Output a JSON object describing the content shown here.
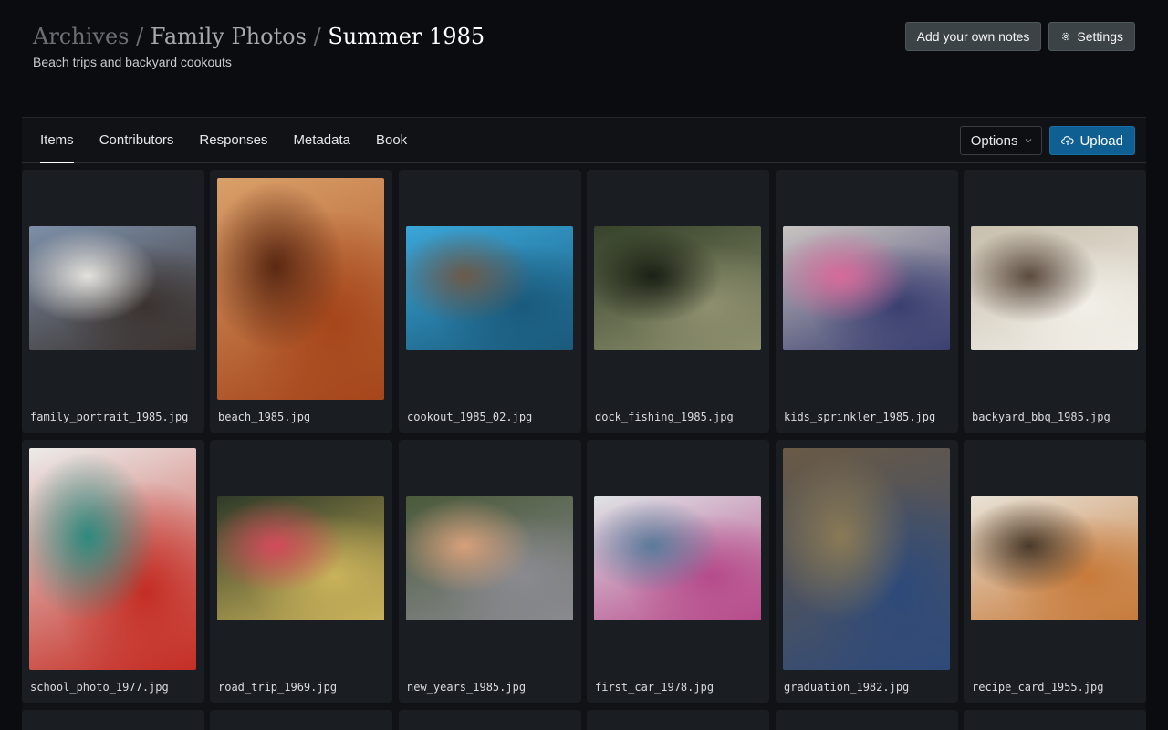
{
  "breadcrumb": {
    "items": [
      "Archives",
      "Family Photos",
      "Summer 1985"
    ],
    "separator": "/"
  },
  "subtitle": "Beach trips and backyard cookouts",
  "header_actions": {
    "notes_label": "Add your own notes",
    "settings_label": "Settings"
  },
  "tabs": [
    {
      "label": "Items",
      "active": true
    },
    {
      "label": "Contributors",
      "active": false
    },
    {
      "label": "Responses",
      "active": false
    },
    {
      "label": "Metadata",
      "active": false
    },
    {
      "label": "Book",
      "active": false
    }
  ],
  "toolbar": {
    "options_label": "Options",
    "upload_label": "Upload"
  },
  "items": [
    {
      "filename": "family_portrait_1985.jpg",
      "orientation": "landscape",
      "colors": [
        "#7d8fa8",
        "#3b3330",
        "#e4e2dd"
      ]
    },
    {
      "filename": "beach_1985.jpg",
      "orientation": "portrait",
      "colors": [
        "#d9a06a",
        "#a5451a",
        "#5a2812"
      ]
    },
    {
      "filename": "cookout_1985_02.jpg",
      "orientation": "landscape",
      "colors": [
        "#3aa6d8",
        "#1a5a7c",
        "#6c5a4a"
      ]
    },
    {
      "filename": "dock_fishing_1985.jpg",
      "orientation": "landscape",
      "colors": [
        "#36432a",
        "#8d8f6e",
        "#1a2014"
      ]
    },
    {
      "filename": "kids_sprinkler_1985.jpg",
      "orientation": "landscape",
      "colors": [
        "#c9c3c1",
        "#3a3f70",
        "#d86a9a"
      ]
    },
    {
      "filename": "backyard_bbq_1985.jpg",
      "orientation": "landscape",
      "colors": [
        "#c8bfad",
        "#f2efe8",
        "#5a4a3d"
      ]
    },
    {
      "filename": "school_photo_1977.jpg",
      "orientation": "portrait",
      "colors": [
        "#ececea",
        "#c42d24",
        "#2d8a7e"
      ]
    },
    {
      "filename": "road_trip_1969.jpg",
      "orientation": "landscape",
      "colors": [
        "#2f3a28",
        "#c9b25a",
        "#d34a5a"
      ]
    },
    {
      "filename": "new_years_1985.jpg",
      "orientation": "landscape",
      "colors": [
        "#4a5a3a",
        "#8a8a90",
        "#d7a07a"
      ]
    },
    {
      "filename": "first_car_1978.jpg",
      "orientation": "landscape",
      "colors": [
        "#dfe3e6",
        "#b64a8a",
        "#5a7a9a"
      ]
    },
    {
      "filename": "graduation_1982.jpg",
      "orientation": "portrait",
      "colors": [
        "#6a5a45",
        "#2e4a7a",
        "#8a7a55"
      ]
    },
    {
      "filename": "recipe_card_1955.jpg",
      "orientation": "landscape",
      "colors": [
        "#e8e2d6",
        "#c77a3a",
        "#4a3a2a"
      ]
    }
  ],
  "icons": {
    "settings": "gear-icon",
    "options": "chevron-down-icon",
    "upload": "cloud-upload-icon"
  },
  "colors": {
    "background": "#0b0c0f",
    "panel": "#101216",
    "card": "#1a1d22",
    "upload": "#0f5f93",
    "gray_button": "#3c4346"
  }
}
